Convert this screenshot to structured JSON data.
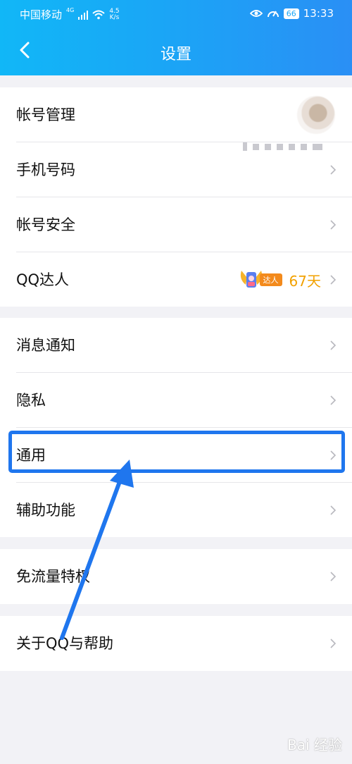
{
  "status_bar": {
    "carrier": "中国移动",
    "net_tag": "4G",
    "speed_value": "4.5",
    "speed_unit": "K/s",
    "battery": "66",
    "time": "13:33"
  },
  "header": {
    "title": "设置"
  },
  "groups": [
    {
      "items": [
        {
          "label": "帐号管理"
        },
        {
          "label": "手机号码"
        },
        {
          "label": "帐号安全"
        },
        {
          "label": "QQ达人",
          "badge_text": "达人",
          "days": "67天"
        }
      ]
    },
    {
      "items": [
        {
          "label": "消息通知"
        },
        {
          "label": "隐私"
        },
        {
          "label": "通用"
        },
        {
          "label": "辅助功能"
        }
      ]
    },
    {
      "items": [
        {
          "label": "免流量特权"
        }
      ]
    },
    {
      "items": [
        {
          "label": "关于QQ与帮助"
        }
      ]
    }
  ],
  "watermark": "Bai 经验",
  "colors": {
    "header_gradient": [
      "#11b7f7",
      "#2a8ff5"
    ],
    "highlight": "#1f76ee",
    "days_text": "#f2a100"
  }
}
